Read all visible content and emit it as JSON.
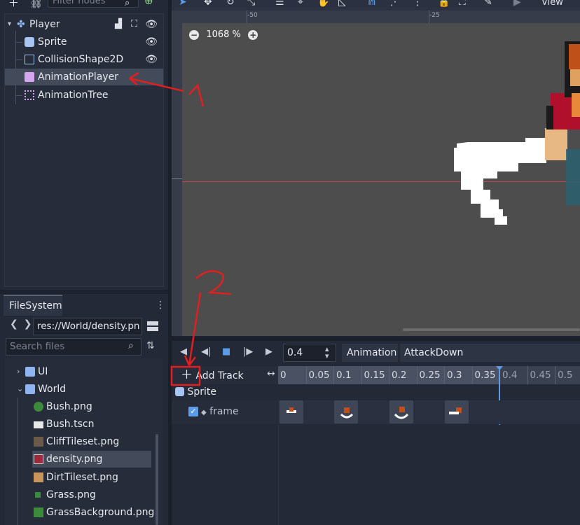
{
  "scene_dock": {
    "filter_placeholder": "Filter nodes",
    "tree": [
      {
        "label": "Player",
        "icon": "kinematic-body-icon",
        "visibility": true
      },
      {
        "label": "Sprite",
        "icon": "sprite-icon",
        "visibility": true
      },
      {
        "label": "CollisionShape2D",
        "icon": "collision-shape-icon",
        "visibility": true
      },
      {
        "label": "AnimationPlayer",
        "icon": "animation-player-icon",
        "selected": true
      },
      {
        "label": "AnimationTree",
        "icon": "animation-tree-icon"
      }
    ]
  },
  "filesystem": {
    "tab_label": "FileSystem",
    "path": "res://World/density.pn",
    "search_placeholder": "Search files",
    "items": [
      {
        "label": "UI",
        "type": "folder",
        "expanded": false
      },
      {
        "label": "World",
        "type": "folder",
        "expanded": true
      },
      {
        "label": "Bush.png",
        "type": "image"
      },
      {
        "label": "Bush.tscn",
        "type": "scene"
      },
      {
        "label": "CliffTileset.png",
        "type": "image"
      },
      {
        "label": "density.png",
        "type": "image",
        "selected": true
      },
      {
        "label": "DirtTileset.png",
        "type": "image"
      },
      {
        "label": "Grass.png",
        "type": "image"
      },
      {
        "label": "GrassBackground.png",
        "type": "image"
      }
    ]
  },
  "viewport": {
    "toolbar_view_label": "View",
    "ruler_top_labels": [
      "-50",
      "-25"
    ],
    "zoom_label": "1068 %"
  },
  "animation": {
    "time_value": "0.4",
    "animation_button": "Animation",
    "current_animation": "AttackDown",
    "add_track_label": "Add Track",
    "timeline_ticks": [
      "0",
      "0.05",
      "0.1",
      "0.15",
      "0.2",
      "0.25",
      "0.3",
      "0.35",
      "0.4",
      "0.45",
      "0.5"
    ],
    "tracks": [
      {
        "node": "Sprite",
        "property": "frame",
        "enabled": true,
        "keyframe_count": 4
      }
    ]
  },
  "annotations": {
    "label_1": "1",
    "label_2": "2",
    "color": "#e02020"
  }
}
